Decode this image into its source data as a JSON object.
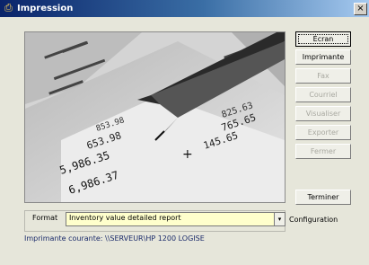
{
  "window": {
    "title": "Impression",
    "close_glyph": "×"
  },
  "image": {
    "numbers": [
      "653.98",
      "853.98",
      "5,986.35",
      "6,986.37",
      "145.65",
      "765.65",
      "825.63"
    ],
    "plus": "+"
  },
  "buttons": [
    {
      "label": "Écran",
      "enabled": true,
      "focused": true
    },
    {
      "label": "Imprimante",
      "enabled": true
    },
    {
      "label": "Fax",
      "enabled": false
    },
    {
      "label": "Courriel",
      "enabled": false
    },
    {
      "label": "Visualiser",
      "enabled": false
    },
    {
      "label": "Exporter",
      "enabled": false
    },
    {
      "label": "Fermer",
      "enabled": false
    },
    {
      "label": "Terminer",
      "enabled": true
    }
  ],
  "format": {
    "label": "Format",
    "value": "Inventory value detailed report",
    "dropdown_glyph": "▾"
  },
  "configuration_label": "Configuration",
  "printer_status": "Imprimante courante: \\\\SERVEUR\\HP 1200 LOGISE",
  "colors": {
    "title_bar": "#0a246a",
    "format_field_bg": "#ffffcc",
    "window_bg": "#e6e6da"
  }
}
